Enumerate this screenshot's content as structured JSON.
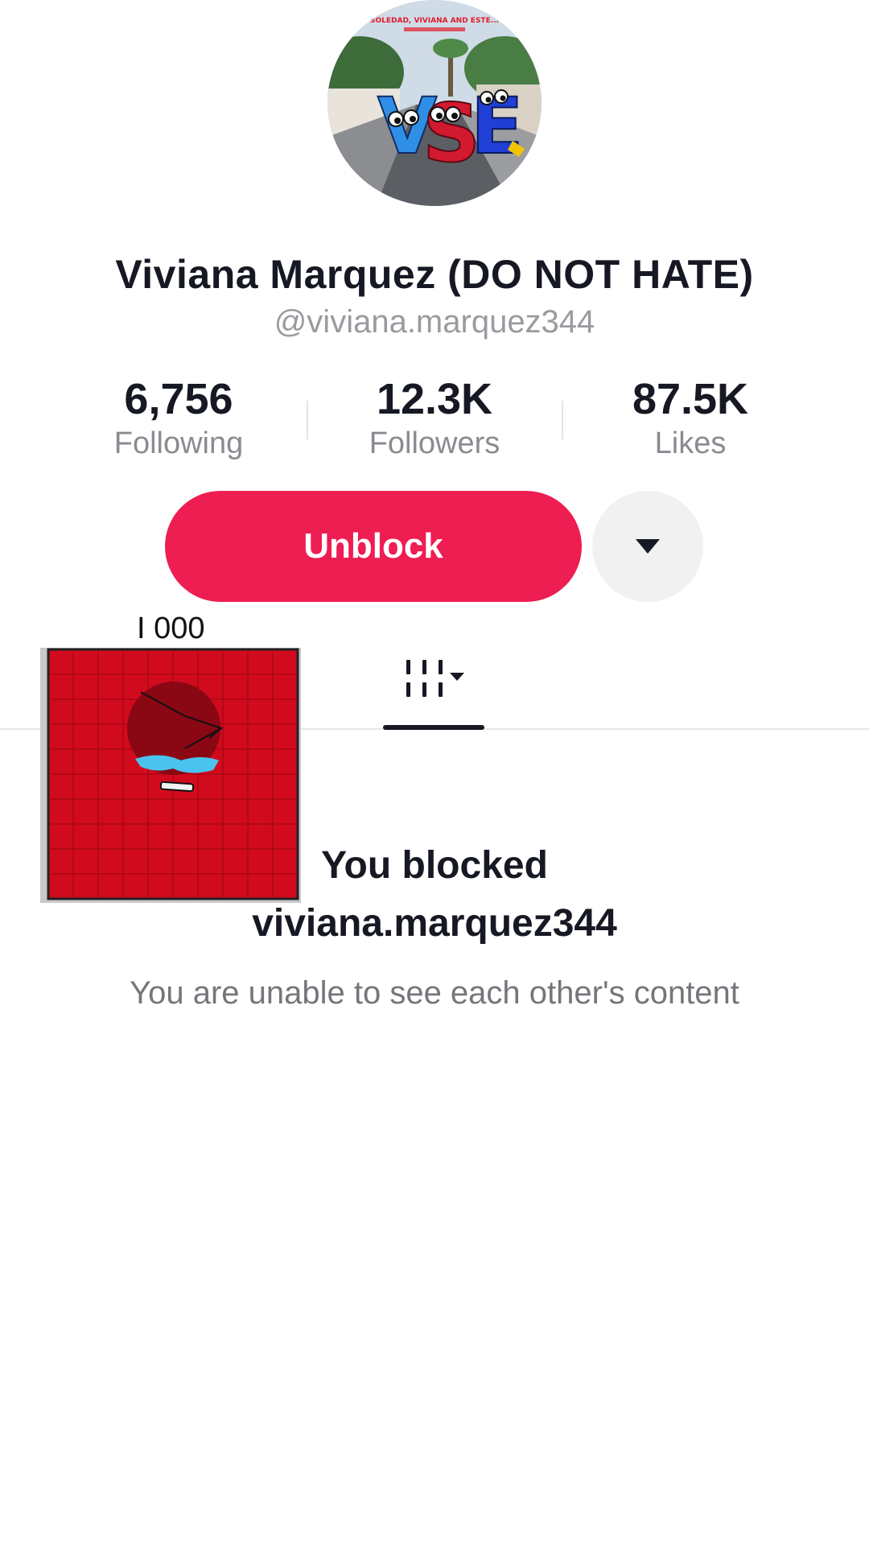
{
  "profile": {
    "display_name": "Viviana Marquez (DO NOT HATE)",
    "handle": "@viviana.marquez344",
    "avatar": {
      "banner_text": "SOLEDAD, VIVIANA AND ESTE...",
      "letters": [
        "V",
        "S",
        "E"
      ]
    }
  },
  "stats": {
    "following": {
      "value": "6,756",
      "label": "Following"
    },
    "followers": {
      "value": "12.3K",
      "label": "Followers"
    },
    "likes": {
      "value": "87.5K",
      "label": "Likes"
    }
  },
  "actions": {
    "unblock_label": "Unblock",
    "more_icon": "caret-down-icon"
  },
  "sticker": {
    "label": "I 000"
  },
  "tabs": {
    "videos_icon": "grid-videos-icon"
  },
  "blocked": {
    "title_line1": "You blocked",
    "title_line2": "viviana.marquez344",
    "subtitle": "You are unable to see each other's content"
  },
  "colors": {
    "accent": "#ee1d52",
    "text_primary": "#161823",
    "text_secondary": "#8a8b91"
  }
}
